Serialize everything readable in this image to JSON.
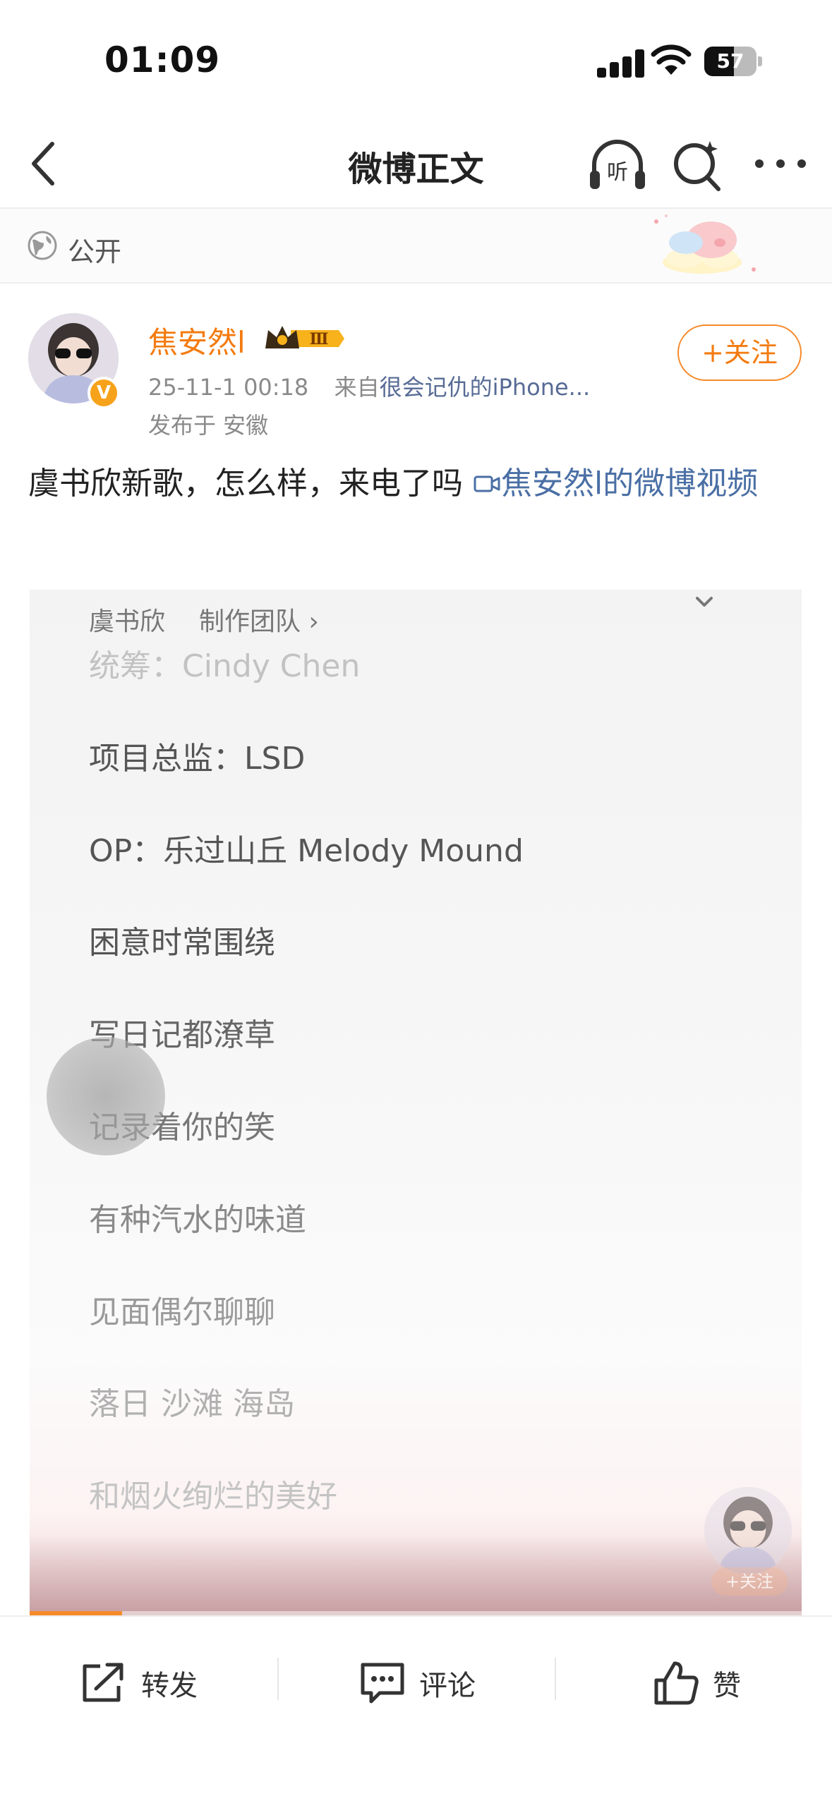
{
  "status_bar": {
    "time": "01:09",
    "battery_level": "57",
    "battery_fraction": 0.57
  },
  "nav": {
    "title": "微博正文",
    "listen_label": "听"
  },
  "visibility": {
    "label": "公开"
  },
  "author": {
    "name": "焦安然l",
    "vip_level": "Ⅲ",
    "verified_mark": "V",
    "post_time": "25-11-1 00:18",
    "source_prefix": "来自",
    "source": "很会记仇的iPhone...",
    "location": "发布于 安徽",
    "follow_label": "+关注"
  },
  "post": {
    "text": "虞书欣新歌，怎么样，来电了吗",
    "video_link": "焦安然l的微博视频"
  },
  "video": {
    "singer": "虞书欣",
    "team": "制作团队",
    "lyrics": [
      {
        "text": "统筹：Cindy Chen",
        "color": "#c2c2c2"
      },
      {
        "text": "项目总监：LSD",
        "color": "#555555"
      },
      {
        "text": "OP：乐过山丘 Melody Mound",
        "color": "#555555"
      },
      {
        "text": "困意时常围绕",
        "color": "#555555"
      },
      {
        "text": "写日记都潦草",
        "color": "#666666"
      },
      {
        "text": "记录着你的笑",
        "color": "#777777"
      },
      {
        "text": "有种汽水的味道",
        "color": "#8a8a8a"
      },
      {
        "text": "见面偶尔聊聊",
        "color": "#9a9a9a"
      },
      {
        "text": "落日 沙滩 海岛",
        "color": "#b0b0b0"
      },
      {
        "text": "和烟火绚烂的美好",
        "color": "#c4c4c4"
      }
    ],
    "mini_follow_label": "+关注",
    "progress": 0.12
  },
  "toolbar": {
    "repost_label": "转发",
    "comment_label": "评论",
    "like_label": "赞"
  },
  "colors": {
    "accent_orange": "#f47b0f",
    "link_blue": "#4a6fa5",
    "source_blue": "#576b95"
  }
}
